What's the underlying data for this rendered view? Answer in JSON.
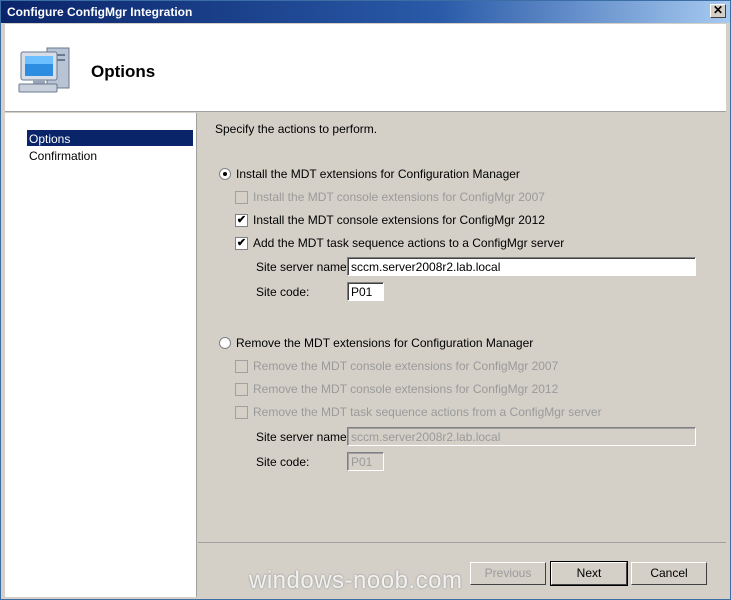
{
  "window": {
    "title": "Configure ConfigMgr Integration",
    "close_glyph": "✕"
  },
  "header": {
    "heading": "Options",
    "icon": "computer-icon"
  },
  "sidebar": {
    "items": [
      {
        "label": "Options",
        "selected": true
      },
      {
        "label": "Confirmation",
        "selected": false
      }
    ]
  },
  "content": {
    "instruction": "Specify the actions to perform.",
    "install": {
      "label": "Install the MDT extensions for Configuration Manager",
      "selected": true,
      "options": [
        {
          "label": "Install the MDT console extensions for ConfigMgr 2007",
          "checked": false,
          "enabled": false
        },
        {
          "label": "Install the MDT console extensions for ConfigMgr 2012",
          "checked": true,
          "enabled": true
        },
        {
          "label": "Add the MDT task sequence actions to a ConfigMgr server",
          "checked": true,
          "enabled": true
        }
      ],
      "site_server_label": "Site server name:",
      "site_server_value": "sccm.server2008r2.lab.local",
      "site_code_label": "Site code:",
      "site_code_value": "P01"
    },
    "remove": {
      "label": "Remove the MDT extensions for Configuration Manager",
      "selected": false,
      "options": [
        {
          "label": "Remove the MDT console extensions for ConfigMgr 2007",
          "checked": false,
          "enabled": false
        },
        {
          "label": "Remove the MDT console extensions for ConfigMgr 2012",
          "checked": false,
          "enabled": false
        },
        {
          "label": "Remove the MDT task sequence actions from a ConfigMgr server",
          "checked": false,
          "enabled": false
        }
      ],
      "site_server_label": "Site server name:",
      "site_server_value": "sccm.server2008r2.lab.local",
      "site_code_label": "Site code:",
      "site_code_value": "P01"
    }
  },
  "buttons": {
    "previous": "Previous",
    "next": "Next",
    "cancel": "Cancel"
  },
  "check_glyph": "✔",
  "watermark": "windows-noob.com"
}
